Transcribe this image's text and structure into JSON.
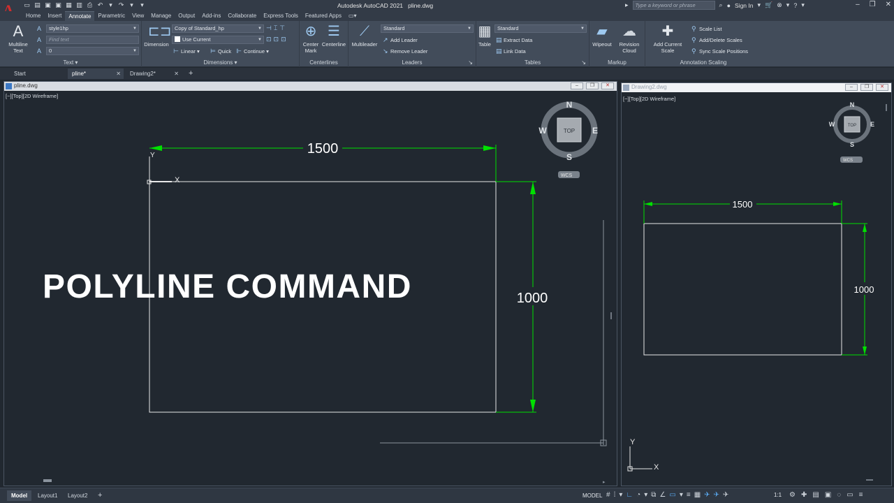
{
  "app": {
    "title": "Autodesk AutoCAD 2021",
    "file": "pline.dwg",
    "logo": "A",
    "search_placeholder": "Type a keyword or phrase",
    "sign_in": "Sign In"
  },
  "ribbon_tabs": [
    "Home",
    "Insert",
    "Annotate",
    "Parametric",
    "View",
    "Manage",
    "Output",
    "Add-ins",
    "Collaborate",
    "Express Tools",
    "Featured Apps"
  ],
  "active_ribbon_tab": "Annotate",
  "ribbon": {
    "text": {
      "title": "Text",
      "multiline_label": "Multiline Text",
      "style_combo": "style1hp",
      "find_text_placeholder": "Find text",
      "height_combo": "0"
    },
    "dimensions": {
      "title": "Dimensions",
      "dimension_label": "Dimension",
      "style_combo": "Copy of Standard_hp",
      "layer_combo": "Use Current",
      "linear_label": "Linear",
      "quick_label": "Quick",
      "continue_label": "Continue"
    },
    "centerlines": {
      "title": "Centerlines",
      "center_mark_label": "Center Mark",
      "centerline_label": "Centerline"
    },
    "leaders": {
      "title": "Leaders",
      "multileader_label": "Multileader",
      "style_combo": "Standard",
      "add_leader_label": "Add Leader",
      "remove_leader_label": "Remove Leader"
    },
    "tables": {
      "title": "Tables",
      "table_label": "Table",
      "style_combo": "Standard",
      "extract_data_label": "Extract Data",
      "link_data_label": "Link Data"
    },
    "markup": {
      "title": "Markup",
      "wipeout_label": "Wipeout",
      "revision_cloud_label": "Revision Cloud"
    },
    "annotation_scaling": {
      "title": "Annotation Scaling",
      "add_current_scale_label": "Add Current Scale",
      "scale_list_label": "Scale List",
      "add_delete_scales_label": "Add/Delete Scales",
      "sync_scale_positions_label": "Sync Scale Positions"
    }
  },
  "doc_tabs": [
    {
      "label": "Start",
      "active": false
    },
    {
      "label": "pline*",
      "active": true
    },
    {
      "label": "Drawing2*",
      "active": false
    }
  ],
  "viewports": {
    "left": {
      "title": "pline.dwg",
      "view_label": "[−][Top][2D Wireframe]",
      "dim_horizontal": "1500",
      "dim_vertical": "1000"
    },
    "right": {
      "title": "Drawing2.dwg",
      "view_label": "[−][Top][2D Wireframe]",
      "dim_horizontal": "1500",
      "dim_vertical": "1000"
    }
  },
  "viewcube": {
    "north": "N",
    "south": "S",
    "east": "E",
    "west": "W",
    "face": "TOP",
    "wcs": "WCS"
  },
  "ucs": {
    "x": "X",
    "y": "Y"
  },
  "overlay_title": "POLYLINE COMMAND",
  "layout_tabs": [
    {
      "label": "Model",
      "active": true
    },
    {
      "label": "Layout1",
      "active": false
    },
    {
      "label": "Layout2",
      "active": false
    }
  ],
  "status": {
    "model_label": "MODEL",
    "scale_label": "1:1"
  },
  "colors": {
    "dimension": "#00e000",
    "geometry": "#e8e8e8",
    "canvas": "#212830"
  }
}
